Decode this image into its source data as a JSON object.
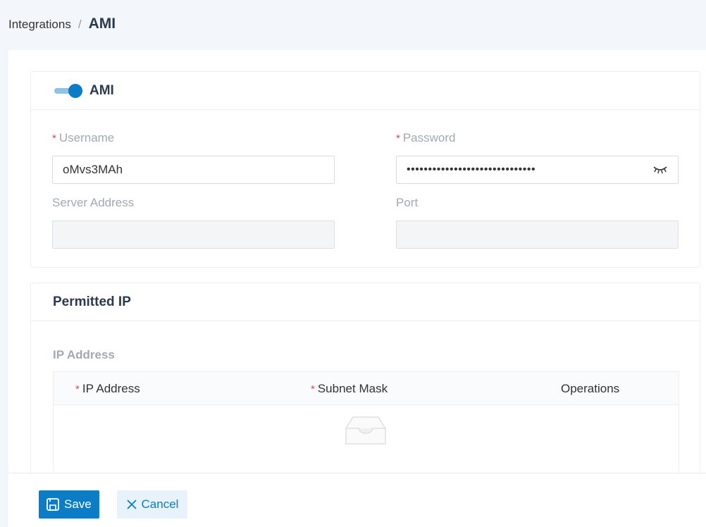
{
  "breadcrumb": {
    "parent": "Integrations",
    "separator": "/",
    "current": "AMI"
  },
  "ami_card": {
    "title": "AMI",
    "toggle_on": true,
    "username": {
      "label": "Username",
      "required_mark": "*",
      "value": "oMvs3MAh"
    },
    "password": {
      "label": "Password",
      "required_mark": "*",
      "masked_value": "••••••••••••••••••••••••••••••"
    },
    "server_address": {
      "label": "Server Address",
      "value": ""
    },
    "port": {
      "label": "Port",
      "value": ""
    }
  },
  "permitted_ip": {
    "title": "Permitted IP",
    "subtitle": "IP Address",
    "columns": [
      {
        "label": "IP Address",
        "required_mark": "*"
      },
      {
        "label": "Subnet Mask",
        "required_mark": "*"
      },
      {
        "label": "Operations"
      }
    ]
  },
  "footer": {
    "save_label": "Save",
    "cancel_label": "Cancel"
  },
  "colors": {
    "primary": "#0b7cc6",
    "required": "#e0464e",
    "label_gray": "#a3a9b2"
  }
}
